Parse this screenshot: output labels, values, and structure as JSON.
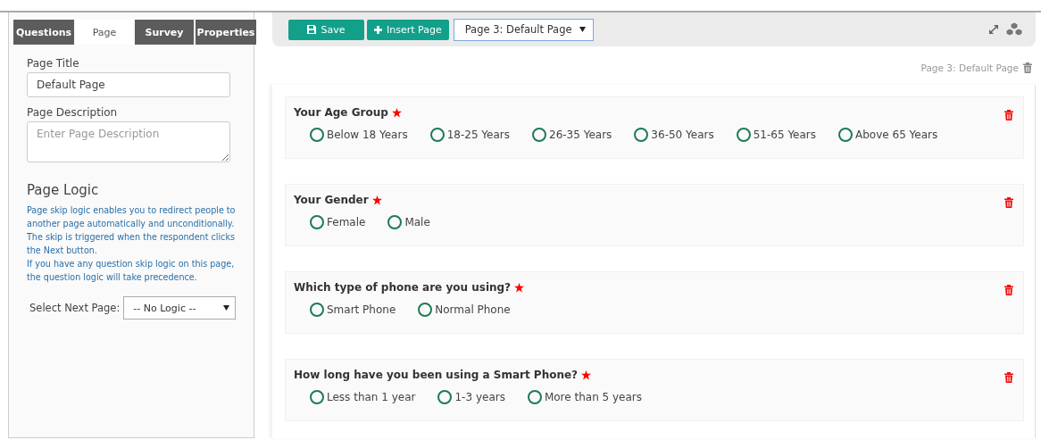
{
  "sidebar": {
    "tabs": [
      {
        "label": "Questions",
        "selected": false
      },
      {
        "label": "Page",
        "selected": true
      },
      {
        "label": "Survey",
        "selected": false
      },
      {
        "label": "Properties",
        "selected": false
      }
    ],
    "page_title": {
      "label": "Page Title",
      "value": "Default Page"
    },
    "page_description": {
      "label": "Page Description",
      "placeholder": "Enter Page Description"
    },
    "page_logic": {
      "heading": "Page Logic",
      "help": [
        "Page skip logic enables you to redirect people to another page automatically and unconditionally. The skip is triggered when the respondent clicks the Next button.",
        "If you have any question skip logic on this page, the question logic will take precedence."
      ],
      "select_label": "Select Next Page:",
      "select_value": "-- No Logic --"
    }
  },
  "toolbar": {
    "save": "Save",
    "insert_page": "Insert Page",
    "page_select": "Page 3:  Default Page"
  },
  "page_header": "Page 3:  Default Page",
  "questions": [
    {
      "text": "Your Age Group",
      "required": true,
      "options": [
        {
          "label": "Below 18 Years",
          "selected": false
        },
        {
          "label": "18-25 Years",
          "selected": false
        },
        {
          "label": "26-35 Years",
          "selected": false
        },
        {
          "label": "36-50 Years",
          "selected": false
        },
        {
          "label": "51-65 Years",
          "selected": false
        },
        {
          "label": "Above 65 Years",
          "selected": false
        }
      ]
    },
    {
      "text": "Your Gender",
      "required": true,
      "options": [
        {
          "label": "Female",
          "selected": false
        },
        {
          "label": "Male",
          "selected": false
        }
      ]
    },
    {
      "text": "Which type of phone are you using?",
      "required": true,
      "options": [
        {
          "label": "Smart Phone",
          "selected": false
        },
        {
          "label": "Normal Phone",
          "selected": false
        }
      ]
    },
    {
      "text": "How long have you been using a Smart Phone?",
      "required": true,
      "options": [
        {
          "label": "Less than 1 year",
          "selected": false
        },
        {
          "label": "1-3 years",
          "selected": false
        },
        {
          "label": "More than 5 years",
          "selected": false
        }
      ]
    }
  ]
}
